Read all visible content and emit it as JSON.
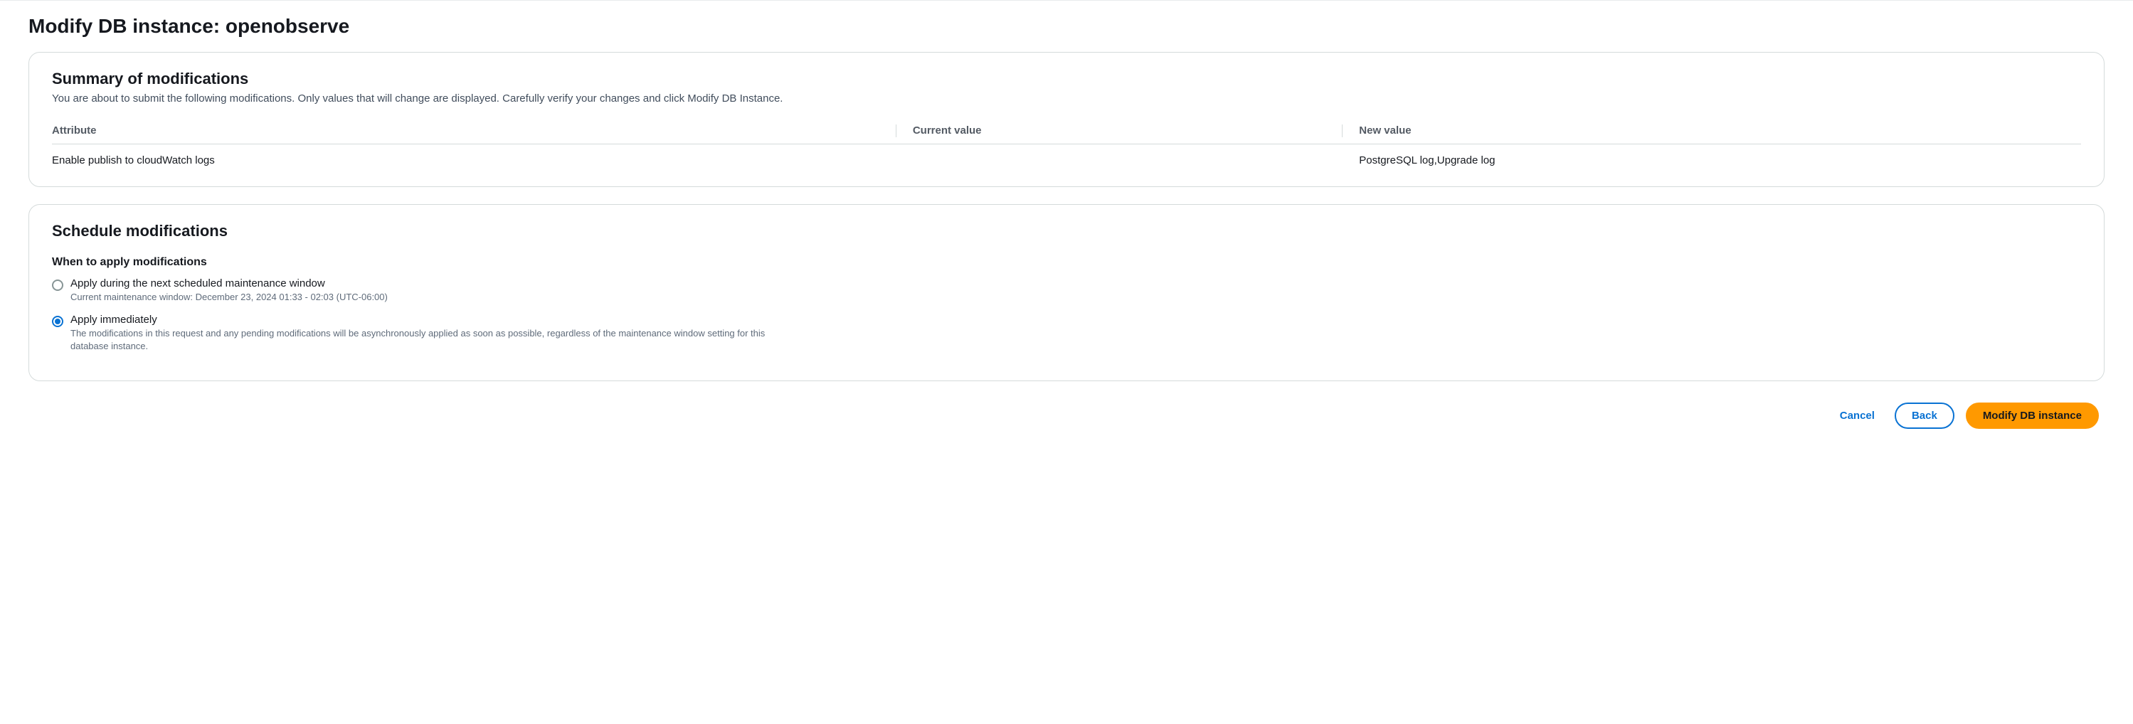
{
  "page": {
    "title": "Modify DB instance: openobserve"
  },
  "summary": {
    "heading": "Summary of modifications",
    "description": "You are about to submit the following modifications. Only values that will change are displayed. Carefully verify your changes and click Modify DB Instance.",
    "columns": {
      "attribute": "Attribute",
      "current": "Current value",
      "new": "New value"
    },
    "rows": [
      {
        "attribute": "Enable publish to cloudWatch logs",
        "current": "",
        "new": "PostgreSQL log,Upgrade log"
      }
    ]
  },
  "schedule": {
    "heading": "Schedule modifications",
    "sub_heading": "When to apply modifications",
    "options": [
      {
        "label": "Apply during the next scheduled maintenance window",
        "description": "Current maintenance window: December 23, 2024 01:33 - 02:03 (UTC-06:00)",
        "selected": false
      },
      {
        "label": "Apply immediately",
        "description": "The modifications in this request and any pending modifications will be asynchronously applied as soon as possible, regardless of the maintenance window setting for this database instance.",
        "selected": true
      }
    ]
  },
  "footer": {
    "cancel": "Cancel",
    "back": "Back",
    "submit": "Modify DB instance"
  }
}
